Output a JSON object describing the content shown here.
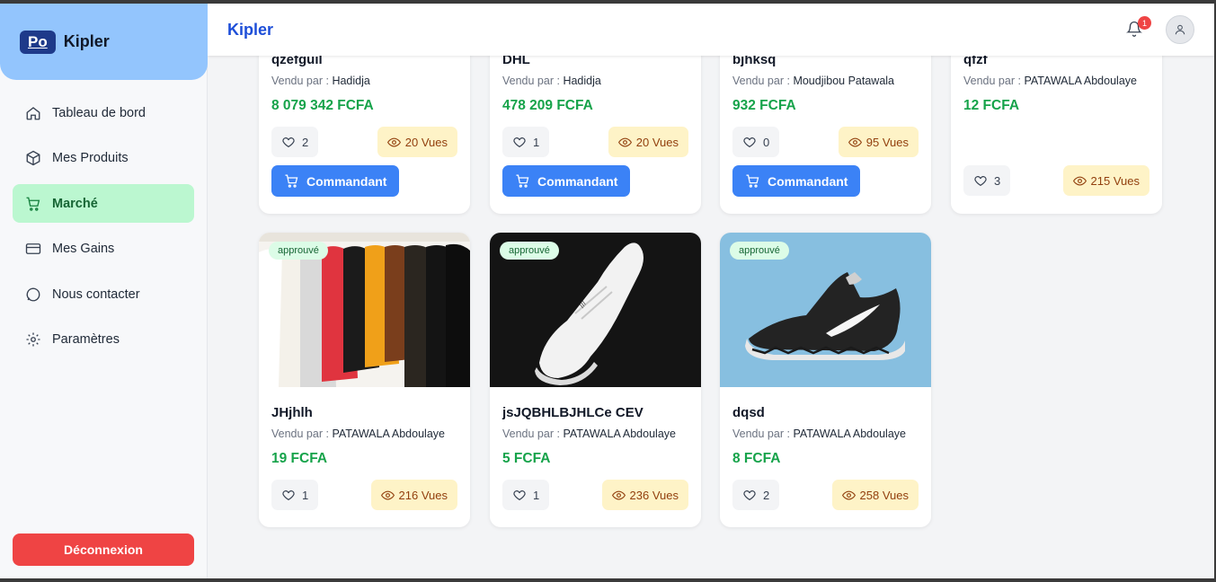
{
  "app": {
    "logo_text": "Po",
    "name": "Kipler"
  },
  "sidebar": {
    "items": [
      {
        "label": "Tableau de bord",
        "icon": "home-icon"
      },
      {
        "label": "Mes Produits",
        "icon": "box-icon"
      },
      {
        "label": "Marché",
        "icon": "cart-icon",
        "active": true
      },
      {
        "label": "Mes Gains",
        "icon": "credit-card-icon"
      },
      {
        "label": "Nous contacter",
        "icon": "chat-icon"
      },
      {
        "label": "Paramètres",
        "icon": "gear-icon"
      }
    ],
    "logout_label": "Déconnexion"
  },
  "header": {
    "title": "Kipler",
    "notification_count": "1"
  },
  "common": {
    "seller_prefix": "Vendu par :",
    "order_label": "Commandant",
    "views_suffix": "Vues",
    "status_badge": "approuvé"
  },
  "products_top": [
    {
      "name": "qzefguil",
      "seller": "Hadidja",
      "price": "8 079 342 FCFA",
      "likes": "2",
      "views": "20 Vues"
    },
    {
      "name": "DHL",
      "seller": "Hadidja",
      "price": "478 209 FCFA",
      "likes": "1",
      "views": "20 Vues"
    },
    {
      "name": "bjhksq",
      "seller": "Moudjibou Patawala",
      "price": "932 FCFA",
      "likes": "0",
      "views": "95 Vues"
    },
    {
      "name": "qfzf",
      "seller": "PATAWALA Abdoulaye",
      "price": "12 FCFA",
      "likes": "3",
      "views": "215 Vues"
    }
  ],
  "products_bottom": [
    {
      "name": "JHjhlh",
      "seller": "PATAWALA Abdoulaye",
      "price": "19 FCFA",
      "likes": "1",
      "views": "216 Vues",
      "badge": "approuvé",
      "image": "clothes-rack-image"
    },
    {
      "name": "jsJQBHLBJHLCe CEV",
      "seller": "PATAWALA Abdoulaye",
      "price": "5 FCFA",
      "likes": "1",
      "views": "236 Vues",
      "badge": "approuvé",
      "image": "white-sneaker-image"
    },
    {
      "name": "dqsd",
      "seller": "PATAWALA Abdoulaye",
      "price": "8 FCFA",
      "likes": "2",
      "views": "258 Vues",
      "badge": "approuvé",
      "image": "black-sneaker-image"
    }
  ]
}
